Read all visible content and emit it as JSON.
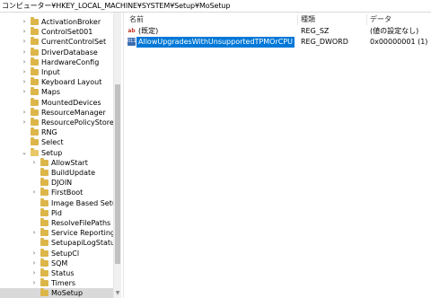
{
  "address": "コンピューター¥HKEY_LOCAL_MACHINE¥SYSTEM¥Setup¥MoSetup",
  "tree": [
    {
      "label": "ActivationBroker",
      "arrow": "›",
      "level": 0
    },
    {
      "label": "ControlSet001",
      "arrow": "›",
      "level": 0
    },
    {
      "label": "CurrentControlSet",
      "arrow": "›",
      "level": 0
    },
    {
      "label": "DriverDatabase",
      "arrow": "›",
      "level": 0
    },
    {
      "label": "HardwareConfig",
      "arrow": "›",
      "level": 0
    },
    {
      "label": "Input",
      "arrow": "›",
      "level": 0
    },
    {
      "label": "Keyboard Layout",
      "arrow": "›",
      "level": 0
    },
    {
      "label": "Maps",
      "arrow": "›",
      "level": 0
    },
    {
      "label": "MountedDevices",
      "arrow": "",
      "level": 0
    },
    {
      "label": "ResourceManager",
      "arrow": "›",
      "level": 0
    },
    {
      "label": "ResourcePolicyStore",
      "arrow": "›",
      "level": 0
    },
    {
      "label": "RNG",
      "arrow": "",
      "level": 0
    },
    {
      "label": "Select",
      "arrow": "",
      "level": 0
    },
    {
      "label": "Setup",
      "arrow": "⌄",
      "level": 0,
      "open": true
    },
    {
      "label": "AllowStart",
      "arrow": "›",
      "level": 1
    },
    {
      "label": "BuildUpdate",
      "arrow": "",
      "level": 1
    },
    {
      "label": "DJOIN",
      "arrow": "",
      "level": 1
    },
    {
      "label": "FirstBoot",
      "arrow": "›",
      "level": 1
    },
    {
      "label": "Image Based Setu",
      "arrow": "",
      "level": 1
    },
    {
      "label": "Pid",
      "arrow": "",
      "level": 1
    },
    {
      "label": "ResolveFilePaths",
      "arrow": "",
      "level": 1
    },
    {
      "label": "Service Reporting",
      "arrow": "›",
      "level": 1
    },
    {
      "label": "SetupapiLogStatu",
      "arrow": "",
      "level": 1
    },
    {
      "label": "SetupCl",
      "arrow": "›",
      "level": 1
    },
    {
      "label": "SQM",
      "arrow": "›",
      "level": 1
    },
    {
      "label": "Status",
      "arrow": "›",
      "level": 1
    },
    {
      "label": "Timers",
      "arrow": "›",
      "level": 1
    },
    {
      "label": "MoSetup",
      "arrow": "",
      "level": 1,
      "selected": true
    }
  ],
  "columns": {
    "name": "名前",
    "type": "種類",
    "data": "データ"
  },
  "values": [
    {
      "icon": "ab",
      "name": "(既定)",
      "type": "REG_SZ",
      "data": "(値の設定なし)",
      "selected": false
    },
    {
      "icon": "011",
      "name": "AllowUpgradesWithUnsupportedTPMOrCPU",
      "type": "REG_DWORD",
      "data": "0x00000001 (1)",
      "selected": true
    }
  ]
}
